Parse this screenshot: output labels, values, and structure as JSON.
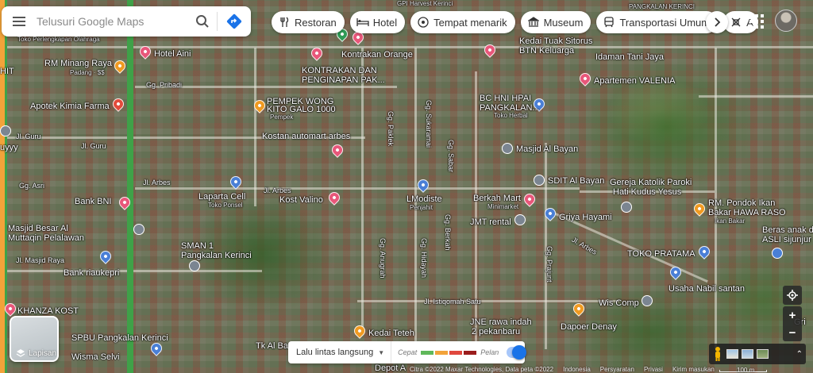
{
  "search": {
    "placeholder": "Telusuri Google Maps"
  },
  "chips": [
    {
      "label": "Restoran",
      "icon": "restaurant-icon"
    },
    {
      "label": "Hotel",
      "icon": "hotel-icon"
    },
    {
      "label": "Tempat menarik",
      "icon": "attraction-icon"
    },
    {
      "label": "Museum",
      "icon": "museum-icon"
    },
    {
      "label": "Transportasi Umum",
      "icon": "transit-icon"
    },
    {
      "label": "A",
      "icon": "activity-icon"
    }
  ],
  "map": {
    "places": [
      {
        "name": "Kedai Tuak Sitorus"
      },
      {
        "name": "BTN Keluarga"
      },
      {
        "name": "Idaman Tani Jaya"
      },
      {
        "name": "Apartemen VALENIA"
      },
      {
        "name": "Kontrakan Orange"
      },
      {
        "name": "KONTRAKAN DAN"
      },
      {
        "name": "PENGINAPAN PAK..."
      },
      {
        "name": "Hotel Aini"
      },
      {
        "name": "RM Minang Raya"
      },
      {
        "name": "Padang · $$"
      },
      {
        "name": "Toko Perlengkapan Olahraga"
      },
      {
        "name": "Apotek Kimia Farma"
      },
      {
        "name": "PEMPEK WONG"
      },
      {
        "name": "KITO GALO 1000"
      },
      {
        "name": "Pempek"
      },
      {
        "name": "Kostan automart arbes"
      },
      {
        "name": "BC HNI HPAI"
      },
      {
        "name": "PANGKALAN..."
      },
      {
        "name": "Toko Herbal"
      },
      {
        "name": "Masjid Al Bayan"
      },
      {
        "name": "SDIT Al Bayan"
      },
      {
        "name": "Gereja Katolik Paroki"
      },
      {
        "name": "Hati Kudus Yesus"
      },
      {
        "name": "RM. Pondok Ikan"
      },
      {
        "name": "Bakar HAWA RASO"
      },
      {
        "name": "Ikan Bakar"
      },
      {
        "name": "Beras anak de"
      },
      {
        "name": "ASLI sijunjur"
      },
      {
        "name": "Laparta Cell"
      },
      {
        "name": "Toko Ponsel"
      },
      {
        "name": "Kost Valino"
      },
      {
        "name": "LModiste"
      },
      {
        "name": "Penjahit"
      },
      {
        "name": "Berkah Mart"
      },
      {
        "name": "Minimarket"
      },
      {
        "name": "JMT rental"
      },
      {
        "name": "Griya Hayami"
      },
      {
        "name": "Bank BNI"
      },
      {
        "name": "Masjid Besar Al"
      },
      {
        "name": "Muttaqin Pelalawan"
      },
      {
        "name": "SMAN 1"
      },
      {
        "name": "Pangkalan Kerinci"
      },
      {
        "name": "Bank riaukepri"
      },
      {
        "name": "TOKO PRATAMA"
      },
      {
        "name": "Usaha Nabil santan"
      },
      {
        "name": "Wis Comp"
      },
      {
        "name": "Dapoer Denay"
      },
      {
        "name": "JNE rawa indah"
      },
      {
        "name": "2 pekanbaru"
      },
      {
        "name": "Kedai Teteh"
      },
      {
        "name": "KHANZA KOST"
      },
      {
        "name": "SPBU Pangkalan Kerinci"
      },
      {
        "name": "Wisma Selvi"
      },
      {
        "name": "Tk Al Ba"
      },
      {
        "name": "Depot A"
      },
      {
        "name": "Gri"
      },
      {
        "name": "HIT"
      },
      {
        "name": "uyyy"
      },
      {
        "name": "PANGKALAN KERINCI"
      },
      {
        "name": "GPI Harvest Kerinci"
      }
    ],
    "roads": [
      {
        "name": "Gg. Pribadi"
      },
      {
        "name": "Jl. Guru"
      },
      {
        "name": "Jl. Guru"
      },
      {
        "name": "Gg. Asri"
      },
      {
        "name": "Jl. Arbes"
      },
      {
        "name": "Jl. Arbes"
      },
      {
        "name": "Jl. Masjid Raya"
      },
      {
        "name": "Gg. Paklek"
      },
      {
        "name": "Gg. Sukaramai"
      },
      {
        "name": "Gg. Sabar"
      },
      {
        "name": "Gg. Anugrah"
      },
      {
        "name": "Gg. Hidayah"
      },
      {
        "name": "Gg. Berkah"
      },
      {
        "name": "Gg. Prajurit"
      },
      {
        "name": "Jl. Arbes"
      },
      {
        "name": "Jl. Istiqomah Satu"
      }
    ]
  },
  "layers": {
    "label": "Lapisan"
  },
  "traffic": {
    "mode": "Lalu lintas langsung",
    "fast": "Cepat",
    "slow": "Pelan",
    "colors": [
      "#5fb85a",
      "#f2a33a",
      "#e0483e",
      "#9b1d1d"
    ],
    "enabled": true
  },
  "attribution": {
    "imagery": "Citra ©2022 Maxar Technologies, Data peta ©2022",
    "country": "Indonesia",
    "terms": "Persyaratan",
    "privacy": "Privasi",
    "feedback": "Kirim masukan"
  },
  "scale": {
    "label": "100 m"
  }
}
